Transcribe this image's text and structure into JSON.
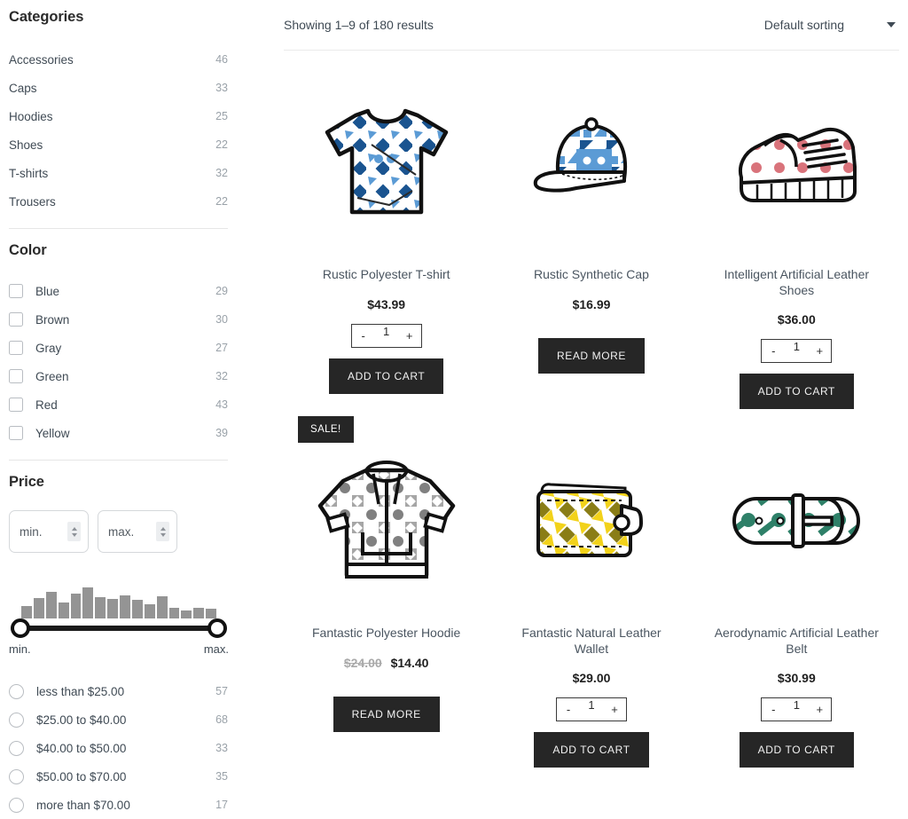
{
  "sidebar": {
    "categories": {
      "title": "Categories",
      "items": [
        {
          "label": "Accessories",
          "count": "46"
        },
        {
          "label": "Caps",
          "count": "33"
        },
        {
          "label": "Hoodies",
          "count": "25"
        },
        {
          "label": "Shoes",
          "count": "22"
        },
        {
          "label": "T-shirts",
          "count": "32"
        },
        {
          "label": "Trousers",
          "count": "22"
        }
      ]
    },
    "color": {
      "title": "Color",
      "items": [
        {
          "label": "Blue",
          "count": "29"
        },
        {
          "label": "Brown",
          "count": "30"
        },
        {
          "label": "Gray",
          "count": "27"
        },
        {
          "label": "Green",
          "count": "32"
        },
        {
          "label": "Red",
          "count": "43"
        },
        {
          "label": "Yellow",
          "count": "39"
        }
      ]
    },
    "price": {
      "title": "Price",
      "min_placeholder": "min.",
      "max_placeholder": "max.",
      "min_value": "",
      "max_value": "",
      "slider_min_label": "min.",
      "slider_max_label": "max.",
      "histogram": [
        30,
        48,
        62,
        38,
        58,
        72,
        50,
        46,
        54,
        44,
        34,
        52,
        24,
        18,
        26,
        22
      ],
      "ranges": [
        {
          "label": "less than $25.00",
          "count": "57"
        },
        {
          "label": "$25.00 to $40.00",
          "count": "68"
        },
        {
          "label": "$40.00 to $50.00",
          "count": "33"
        },
        {
          "label": "$50.00 to $70.00",
          "count": "35"
        },
        {
          "label": "more than $70.00",
          "count": "17"
        }
      ]
    }
  },
  "toolbar": {
    "showing": "Showing 1–9 of 180 results",
    "sorting_selected": "Default sorting"
  },
  "labels": {
    "add_to_cart": "ADD TO CART",
    "read_more": "READ MORE",
    "sale": "SALE!",
    "minus": "-",
    "plus": "+"
  },
  "products": [
    {
      "name": "Rustic Polyester T-shirt",
      "price": "$43.99",
      "old_price": "",
      "qty": "1",
      "action": "add",
      "sale": false,
      "icon": "tshirt-icon",
      "colors": {
        "dark": "#1a5490",
        "light": "#5b9bd5"
      }
    },
    {
      "name": "Rustic Synthetic Cap",
      "price": "$16.99",
      "old_price": "",
      "qty": "",
      "action": "read",
      "sale": false,
      "icon": "cap-icon",
      "colors": {
        "dark": "#1a5490",
        "light": "#5b9bd5"
      }
    },
    {
      "name": "Intelligent Artificial Leather Shoes",
      "price": "$36.00",
      "old_price": "",
      "qty": "1",
      "action": "add",
      "sale": false,
      "icon": "shoes-icon",
      "colors": {
        "dark": "#d9737b",
        "light": "#e79aa0"
      }
    },
    {
      "name": "Fantastic Polyester Hoodie",
      "price": "$14.40",
      "old_price": "$24.00",
      "qty": "",
      "action": "read",
      "sale": true,
      "icon": "hoodie-icon",
      "colors": {
        "dark": "#808080",
        "light": "#a6a6a6"
      }
    },
    {
      "name": "Fantastic Natural Leather Wallet",
      "price": "$29.00",
      "old_price": "",
      "qty": "1",
      "action": "add",
      "sale": false,
      "icon": "wallet-icon",
      "colors": {
        "dark": "#8a7d16",
        "light": "#f2d21a"
      }
    },
    {
      "name": "Aerodynamic Artificial Leather Belt",
      "price": "$30.99",
      "old_price": "",
      "qty": "1",
      "action": "add",
      "sale": false,
      "icon": "belt-icon",
      "colors": {
        "dark": "#2e8068",
        "light": "#2e8068"
      }
    }
  ]
}
